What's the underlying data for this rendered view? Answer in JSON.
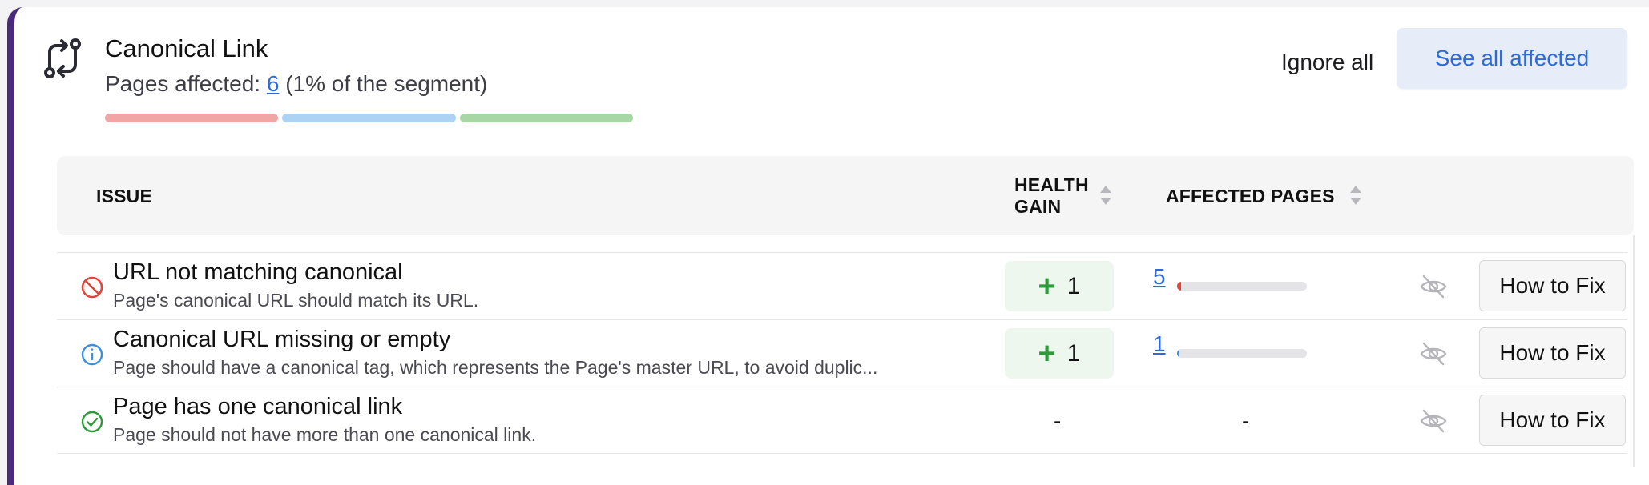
{
  "section": {
    "icon": "canonical-link-icon",
    "title": "Canonical Link",
    "pages_affected_label": "Pages affected:",
    "pages_affected_count": "6",
    "pages_affected_suffix": "(1% of the segment)",
    "segment_bar_colors": [
      "#f1a6a6",
      "#acd3f4",
      "#a7d7a5"
    ],
    "ignore_all_label": "Ignore all",
    "see_all_label": "See all affected"
  },
  "table": {
    "headers": {
      "issue": "ISSUE",
      "health_gain_line1": "HEALTH",
      "health_gain_line2": "GAIN",
      "affected_pages": "AFFECTED PAGES"
    },
    "rows": [
      {
        "status": "error",
        "status_icon": "no-entry-icon",
        "status_color": "#e0453a",
        "title": "URL not matching canonical",
        "description": "Page's canonical URL should match its URL.",
        "health_gain": "1",
        "affected_count": "5",
        "affected_fraction": 0.03,
        "affected_color": "#e0453a",
        "hide_icon": "eye-slash-icon",
        "fix_label": "How to Fix"
      },
      {
        "status": "info",
        "status_icon": "info-icon",
        "status_color": "#3a8fe0",
        "title": "Canonical URL missing or empty",
        "description": "Page should have a canonical tag, which represents the Page's master URL, to avoid duplic...",
        "health_gain": "1",
        "affected_count": "1",
        "affected_fraction": 0.02,
        "affected_color": "#3a8fe0",
        "hide_icon": "eye-slash-icon",
        "fix_label": "How to Fix"
      },
      {
        "status": "passed",
        "status_icon": "check-circle-icon",
        "status_color": "#2e9a3a",
        "title": "Page has one canonical link",
        "description": "Page should not have more than one canonical link.",
        "health_gain": "-",
        "affected_count": "-",
        "hide_icon": "eye-slash-icon",
        "fix_label": "How to Fix"
      }
    ]
  }
}
